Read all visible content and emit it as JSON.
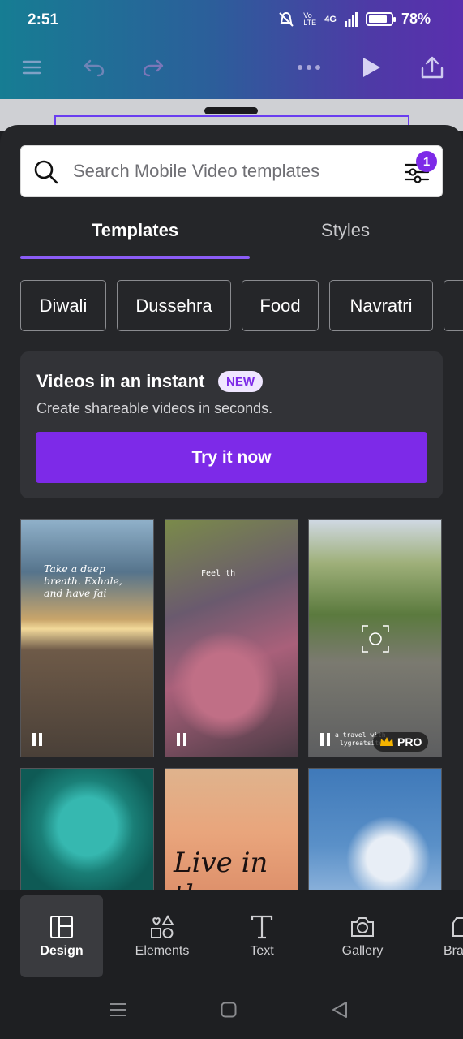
{
  "status_bar": {
    "time": "2:51",
    "network": "4G",
    "volte": "Vo LTE",
    "battery": "78%"
  },
  "search": {
    "placeholder": "Search Mobile Video templates",
    "filter_badge": "1"
  },
  "tabs": [
    {
      "label": "Templates",
      "active": true
    },
    {
      "label": "Styles",
      "active": false
    }
  ],
  "chips": [
    "Diwali",
    "Dussehra",
    "Food",
    "Navratri"
  ],
  "promo": {
    "title": "Videos in an instant",
    "badge": "NEW",
    "subtitle": "Create shareable videos in seconds.",
    "button": "Try it now"
  },
  "templates": {
    "t1_quote": "Take a deep breath. Exhale, and have fai",
    "t2_text": "Feel th",
    "t3_text": "a travel with",
    "t3_text2": "lygreatsite",
    "t5_text": "Live in the",
    "pro_label": "PRO"
  },
  "bottom_nav": [
    {
      "label": "Design",
      "icon": "layout-icon",
      "active": true
    },
    {
      "label": "Elements",
      "icon": "shapes-icon",
      "active": false
    },
    {
      "label": "Text",
      "icon": "text-t-icon",
      "active": false
    },
    {
      "label": "Gallery",
      "icon": "camera-icon",
      "active": false
    },
    {
      "label": "Bra",
      "icon": "brand-icon",
      "active": false
    }
  ],
  "colors": {
    "accent": "#7d2ae8",
    "sheet": "#252629",
    "tab_underline": "#8b5cf6"
  }
}
